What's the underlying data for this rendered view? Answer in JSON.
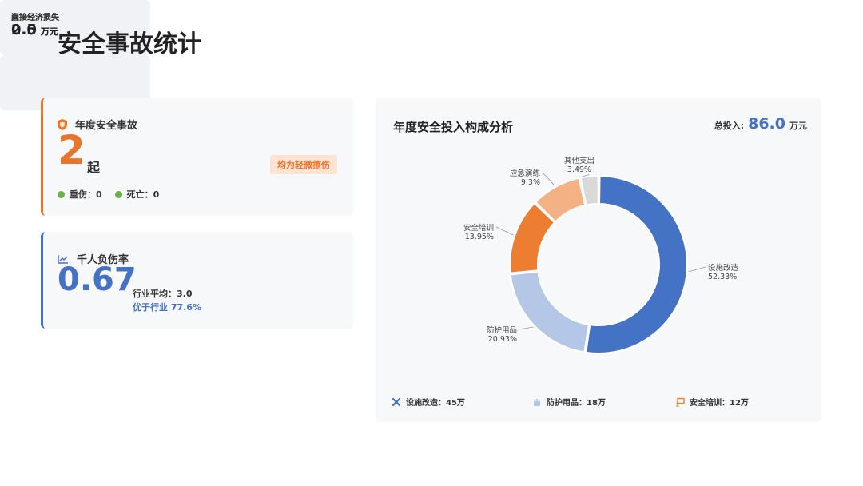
{
  "page": {
    "title": "安全事故统计"
  },
  "accident": {
    "title": "年度安全事故",
    "value": "2",
    "unit": "起",
    "tag": "均为轻微擦伤",
    "serious_label": "重伤：0",
    "death_label": "死亡：0",
    "accent": "#e9752c"
  },
  "injury_rate": {
    "title": "千人负伤率",
    "value": "0.67",
    "avg": "行业平均：3.0",
    "better": "优于行业 77.6%",
    "accent": "#4472c4"
  },
  "losses": {
    "direct": {
      "label": "直接经济损失",
      "value": "0.5",
      "unit": "万元"
    },
    "indirect": {
      "label": "间接经济损失",
      "value": "2.0",
      "unit": "万元"
    }
  },
  "investment": {
    "title": "年度安全投入构成分析",
    "total_label": "总投入:",
    "total_value": "86.0",
    "total_unit": "万元",
    "legend": [
      {
        "icon": "tools-icon",
        "label": "设施改造：45万"
      },
      {
        "icon": "gloves-icon",
        "label": "防护用品：18万"
      },
      {
        "icon": "training-icon",
        "label": "安全培训：12万"
      }
    ]
  },
  "chart_data": {
    "type": "pie",
    "donut": true,
    "slices": [
      {
        "name": "设施改造",
        "value": 52.33,
        "label": "52.33%",
        "color": "#4472c4"
      },
      {
        "name": "防护用品",
        "value": 20.93,
        "label": "20.93%",
        "color": "#b4c7e7"
      },
      {
        "name": "安全培训",
        "value": 13.95,
        "label": "13.95%",
        "color": "#ed7d31"
      },
      {
        "name": "应急演练",
        "value": 9.3,
        "label": "9.3%",
        "color": "#f4b183"
      },
      {
        "name": "其他支出",
        "value": 3.49,
        "label": "3.49%",
        "color": "#d9d9d9"
      }
    ]
  }
}
